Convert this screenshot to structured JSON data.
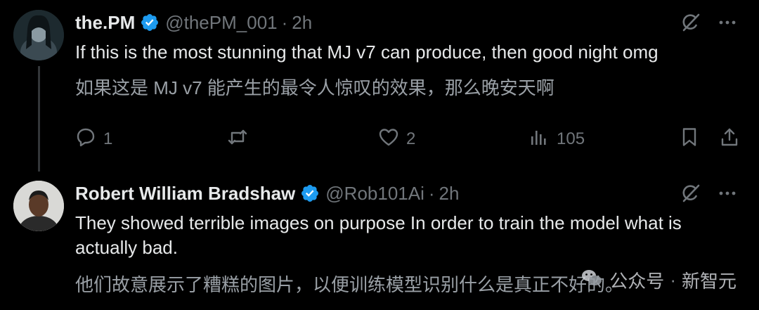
{
  "tweets": [
    {
      "author_name": "the.PM",
      "handle": "@thePM_001",
      "separator": "·",
      "time": "2h",
      "text": "If this is the most stunning that MJ v7 can produce, then good night omg",
      "translation": "如果这是 MJ v7 能产生的最令人惊叹的效果，那么晚安天啊",
      "replies": "1",
      "likes": "2",
      "views": "105"
    },
    {
      "author_name": "Robert William Bradshaw",
      "handle": "@Rob101Ai",
      "separator": "·",
      "time": "2h",
      "text": "They showed terrible images on purpose In order to train the model what is actually bad.",
      "translation": "他们故意展示了糟糕的图片，以便训练模型识别什么是真正不好的。"
    }
  ],
  "watermark": {
    "label": "公众号",
    "separator": "·",
    "brand": "新智元"
  },
  "colors": {
    "background": "#000000",
    "primary_text": "#e7e9ea",
    "secondary_text": "#71767b",
    "verified_badge": "#1d9bf0",
    "divider": "#333639"
  },
  "icons": [
    "verified-badge-icon",
    "grok-icon",
    "more-icon",
    "reply-icon",
    "retweet-icon",
    "like-icon",
    "views-icon",
    "bookmark-icon",
    "share-icon"
  ]
}
